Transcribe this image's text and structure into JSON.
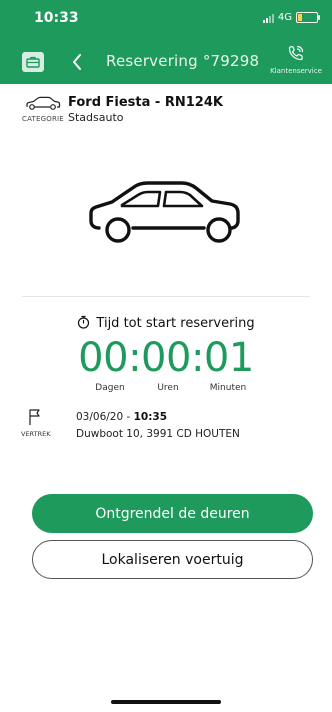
{
  "status": {
    "time": "10:33",
    "network": "4G"
  },
  "nav": {
    "title": "Reservering °79298",
    "service_label": "Klantenservice"
  },
  "vehicle": {
    "name": "Ford Fiesta - RN124K",
    "category_label": "CATEGORIE",
    "category_value": "Stadsauto"
  },
  "timer": {
    "title": "Tijd tot start reservering",
    "countdown": "00:00:01",
    "units": [
      "Dagen",
      "Uren",
      "Minuten"
    ]
  },
  "departure": {
    "label": "VERTREK",
    "date": "03/06/20 - ",
    "time": "10:35",
    "address": "Duwboot 10, 3991 CD HOUTEN"
  },
  "actions": {
    "unlock_label": "Ontgrendel de deuren",
    "locate_label": "Lokaliseren voertuig"
  },
  "colors": {
    "brand_green": "#1d9a5c",
    "battery_low": "#f1d54a"
  }
}
